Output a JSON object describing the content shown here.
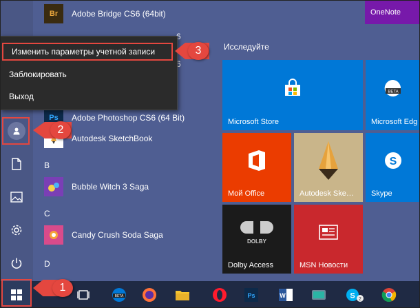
{
  "app_list": {
    "items": [
      {
        "label": "Adobe Bridge CS6 (64bit)",
        "icon": "Br"
      },
      {
        "label": "Adobe Photoshop CS6 (64 Bit)",
        "icon": "Ps"
      },
      {
        "label": "Autodesk SketchBook",
        "icon": "sketchbook-icon"
      },
      {
        "label": "Bubble Witch 3 Saga",
        "icon": "bubble-witch-icon"
      },
      {
        "label": "Candy Crush Soda Saga",
        "icon": "candy-crush-icon"
      }
    ],
    "partial_cs6_a": "6",
    "partial_cs6_b": "6",
    "headers": {
      "b": "B",
      "c": "C",
      "d": "D"
    }
  },
  "account_menu": {
    "items": [
      {
        "label": "Изменить параметры учетной записи"
      },
      {
        "label": "Заблокировать"
      },
      {
        "label": "Выход"
      }
    ]
  },
  "tiles": {
    "group_title": "Исследуйте",
    "onenote": "OneNote",
    "microsoft_store": "Microsoft Store",
    "microsoft_edge": "Microsoft Edg",
    "my_office": "Мой Office",
    "autodesk": "Autodesk Ske…",
    "skype": "Skype",
    "dolby": "Dolby Access",
    "msn": "MSN Новости"
  },
  "callouts": {
    "one": "1",
    "two": "2",
    "three": "3"
  },
  "colors": {
    "accent": "#e4473f",
    "start_bg": "#4f5e92",
    "taskbar": "#1f2a44",
    "tile_blue": "#0078d7",
    "tile_red": "#eb3c00",
    "tile_purple": "#7719aa"
  }
}
